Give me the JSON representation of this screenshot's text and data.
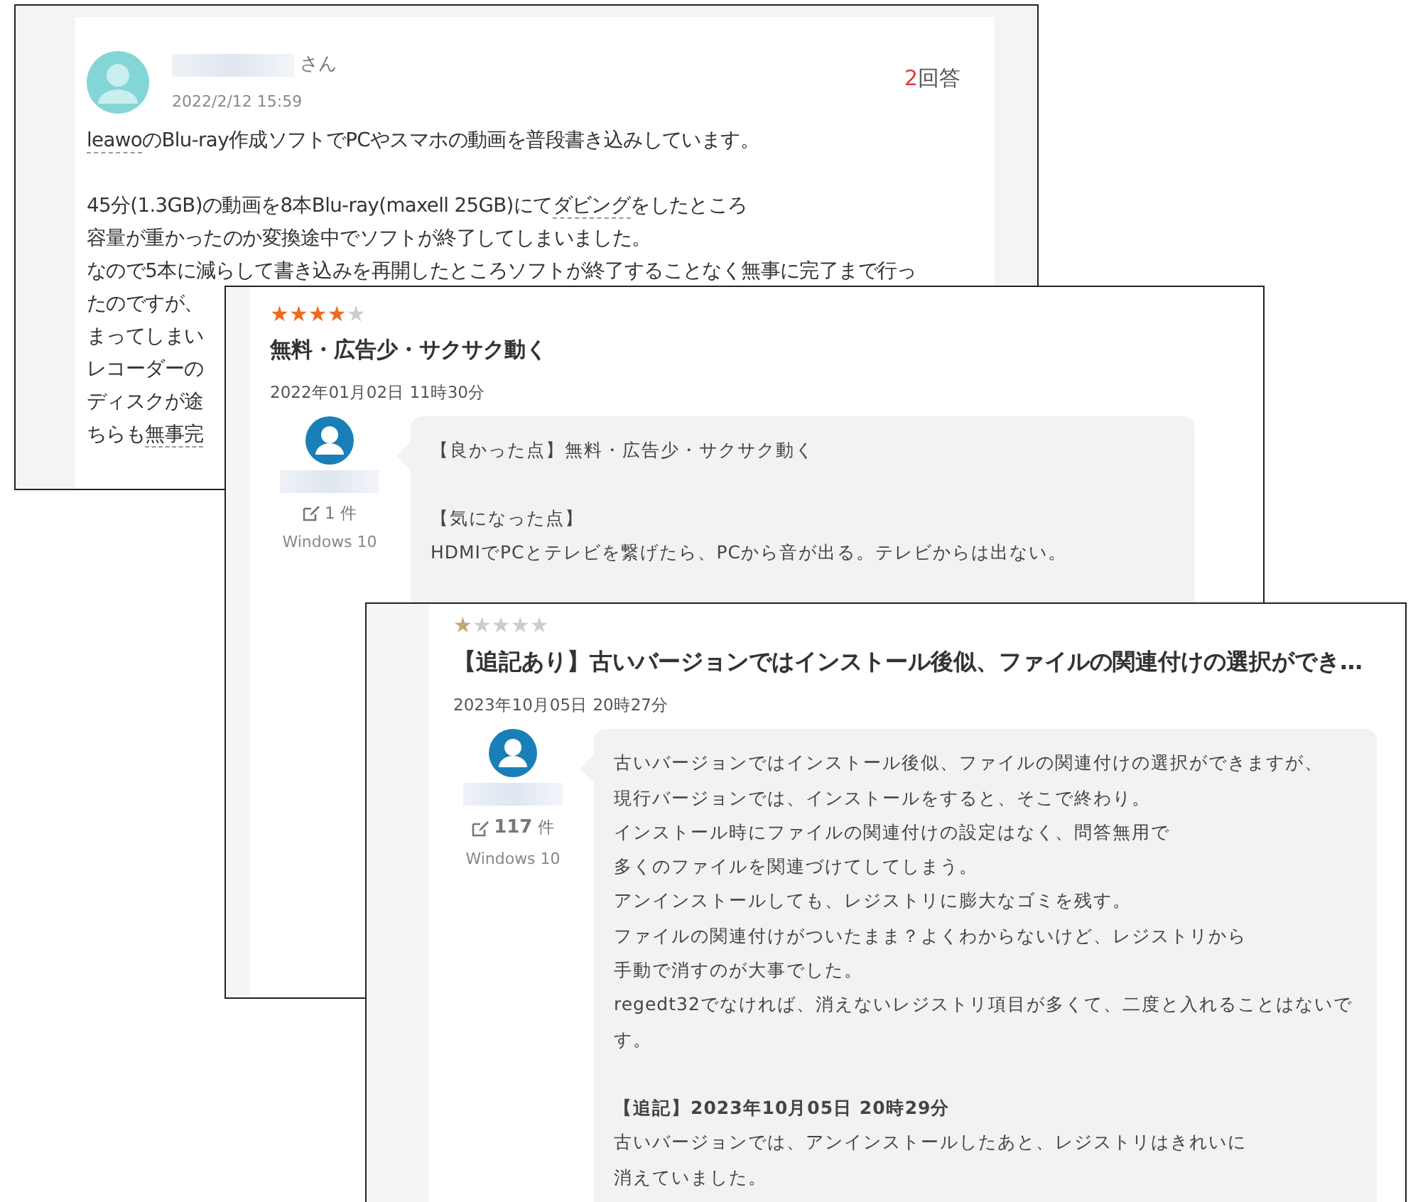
{
  "question": {
    "name_suffix": "さん",
    "date": "2022/2/12 15:59",
    "answer_count": "2",
    "answer_label": "回答",
    "lines": [
      {
        "kind": "text",
        "segments": [
          {
            "kind": "keyword",
            "text": "leawo"
          },
          {
            "kind": "plain",
            "text": "のBlu-ray作成ソフトでPCやスマホの動画を普段書き込みしています。"
          }
        ]
      },
      {
        "kind": "blank"
      },
      {
        "kind": "text",
        "segments": [
          {
            "kind": "plain",
            "text": "45分(1.3GB)の動画を8本Blu-ray(maxell 25GB)にて"
          },
          {
            "kind": "keyword",
            "text": "ダビング"
          },
          {
            "kind": "plain",
            "text": "をしたところ"
          }
        ]
      },
      {
        "kind": "text",
        "segments": [
          {
            "kind": "plain",
            "text": "容量が重かったのか変換途中でソフトが終了してしまいました。"
          }
        ]
      },
      {
        "kind": "text",
        "segments": [
          {
            "kind": "plain",
            "text": "なので5本に減らして書き込みを再開したところソフトが終了することなく無事に完了まで行っ"
          }
        ]
      },
      {
        "kind": "text",
        "segments": [
          {
            "kind": "plain",
            "text": "たのですが、"
          }
        ]
      },
      {
        "kind": "text",
        "segments": [
          {
            "kind": "plain",
            "text": "まってしまい"
          }
        ]
      },
      {
        "kind": "text",
        "segments": [
          {
            "kind": "plain",
            "text": "レコーダーの"
          }
        ]
      },
      {
        "kind": "text",
        "segments": [
          {
            "kind": "plain",
            "text": "ディスクが途"
          }
        ]
      },
      {
        "kind": "text",
        "segments": [
          {
            "kind": "plain",
            "text": "ちらも"
          },
          {
            "kind": "keyword",
            "text": "無事完"
          }
        ]
      }
    ]
  },
  "reviews": [
    {
      "stars": 4,
      "color": "#f26b1d",
      "title": "無料・広告少・サクサク動く",
      "date": "2022年01月02日 11時30分",
      "count": "1",
      "count_unit": "件",
      "os": "Windows 10",
      "body": [
        {
          "kind": "line",
          "text": "【良かった点】無料・広告少・サクサク動く"
        },
        {
          "kind": "blank"
        },
        {
          "kind": "line",
          "text": "【気になった点】"
        },
        {
          "kind": "line",
          "text": "HDMIでPCとテレビを繋げたら、PCから音が出る。テレビからは出ない。"
        }
      ]
    },
    {
      "stars": 1,
      "color": "#c4a574",
      "title": "【追記あり】古いバージョンではインストール後似、ファイルの関連付けの選択ができ…",
      "date": "2023年10月05日 20時27分",
      "count": "117",
      "count_unit": "件",
      "os": "Windows 10",
      "body": [
        {
          "kind": "line",
          "text": "古いバージョンではインストール後似、ファイルの関連付けの選択ができますが、"
        },
        {
          "kind": "line",
          "text": "現行バージョンでは、インストールをすると、そこで終わり。"
        },
        {
          "kind": "line",
          "text": "インストール時にファイルの関連付けの設定はなく、問答無用で"
        },
        {
          "kind": "line",
          "text": "多くのファイルを関連づけてしてしまう。"
        },
        {
          "kind": "line",
          "text": "アンインストールしても、レジストリに膨大なゴミを残す。"
        },
        {
          "kind": "line",
          "text": "ファイルの関連付けがついたまま？よくわからないけど、レジストリから"
        },
        {
          "kind": "line",
          "text": "手動で消すのが大事でした。"
        },
        {
          "kind": "line",
          "text": "regedt32でなければ、消えないレジストリ項目が多くて、二度と入れることはないで"
        },
        {
          "kind": "line",
          "text": "す。"
        },
        {
          "kind": "blank"
        },
        {
          "kind": "heading",
          "text": "【追記】2023年10月05日 20時29分"
        },
        {
          "kind": "line",
          "text": "古いバージョンでは、アンインストールしたあと、レジストリはきれいに"
        },
        {
          "kind": "line",
          "text": "消えていました。"
        }
      ]
    }
  ]
}
